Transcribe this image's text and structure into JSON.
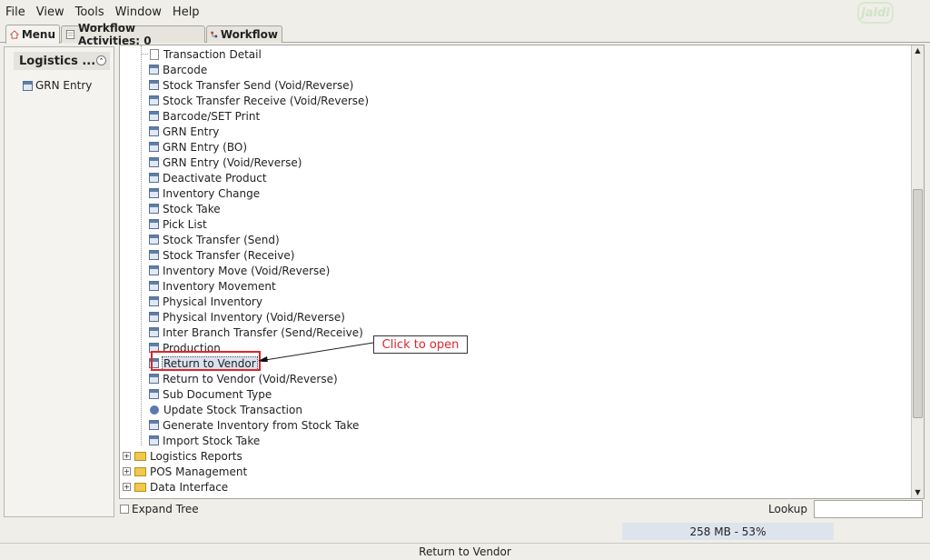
{
  "menubar": {
    "items": [
      {
        "label": "File"
      },
      {
        "label": "View"
      },
      {
        "label": "Tools"
      },
      {
        "label": "Window"
      },
      {
        "label": "Help"
      }
    ],
    "logo_text": "jaldi"
  },
  "tabs": [
    {
      "label": "Menu",
      "icon": "home-icon",
      "active": true
    },
    {
      "label": "Workflow Activities: 0",
      "icon": "document-icon",
      "active": false
    },
    {
      "label": "Workflow",
      "icon": "workflow-icon",
      "active": false
    }
  ],
  "left_panel": {
    "title": "Logistics ...",
    "items": [
      {
        "label": "GRN Entry",
        "icon": "form-icon"
      }
    ]
  },
  "tree": {
    "items": [
      {
        "label": "Transaction Detail",
        "icon": "page-icon"
      },
      {
        "label": "Barcode",
        "icon": "form-icon"
      },
      {
        "label": "Stock Transfer Send (Void/Reverse)",
        "icon": "form-icon"
      },
      {
        "label": "Stock Transfer Receive (Void/Reverse)",
        "icon": "form-icon"
      },
      {
        "label": "Barcode/SET Print",
        "icon": "form-icon"
      },
      {
        "label": "GRN Entry",
        "icon": "form-icon"
      },
      {
        "label": "GRN Entry (BO)",
        "icon": "form-icon"
      },
      {
        "label": "GRN Entry (Void/Reverse)",
        "icon": "form-icon"
      },
      {
        "label": "Deactivate Product",
        "icon": "form-icon"
      },
      {
        "label": "Inventory Change",
        "icon": "form-icon"
      },
      {
        "label": "Stock Take",
        "icon": "form-icon"
      },
      {
        "label": "Pick List",
        "icon": "form-icon"
      },
      {
        "label": "Stock Transfer (Send)",
        "icon": "form-icon"
      },
      {
        "label": "Stock Transfer (Receive)",
        "icon": "form-icon"
      },
      {
        "label": "Inventory Move (Void/Reverse)",
        "icon": "form-icon"
      },
      {
        "label": "Inventory Movement",
        "icon": "form-icon"
      },
      {
        "label": "Physical Inventory",
        "icon": "form-icon"
      },
      {
        "label": "Physical Inventory (Void/Reverse)",
        "icon": "form-icon"
      },
      {
        "label": "Inter Branch Transfer (Send/Receive)",
        "icon": "form-icon"
      },
      {
        "label": "Production",
        "icon": "form-icon"
      },
      {
        "label": "Return to Vendor",
        "icon": "form-icon",
        "selected": true
      },
      {
        "label": "Return to Vendor (Void/Reverse)",
        "icon": "form-icon"
      },
      {
        "label": "Sub Document Type",
        "icon": "form-icon"
      },
      {
        "label": "Update Stock Transaction",
        "icon": "gear-icon"
      },
      {
        "label": "Generate Inventory from Stock Take",
        "icon": "form-icon"
      },
      {
        "label": "Import Stock Take",
        "icon": "form-icon"
      }
    ],
    "folders": [
      {
        "label": "Logistics Reports",
        "icon": "folder-icon"
      },
      {
        "label": "POS Management",
        "icon": "folder-icon"
      },
      {
        "label": "Data Interface",
        "icon": "folder-icon"
      }
    ]
  },
  "annotation": {
    "callout": "Click to open",
    "color": "#e0242a"
  },
  "bottom": {
    "expand_tree": "Expand Tree",
    "lookup_label": "Lookup",
    "lookup_value": "",
    "memory": "258 MB - 53%",
    "status": "Return to Vendor"
  }
}
